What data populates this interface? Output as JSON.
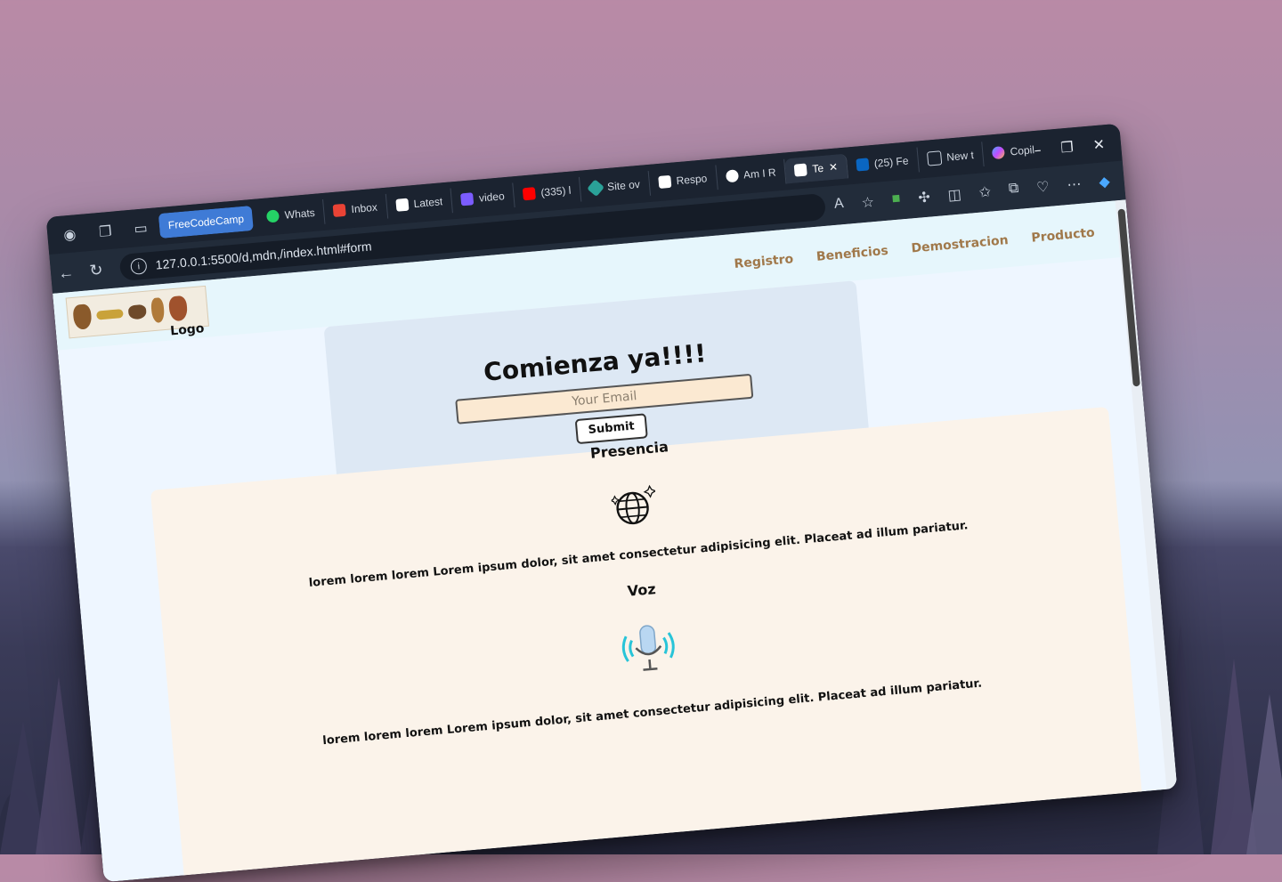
{
  "browser": {
    "tab_group_label": "FreeCodeCamp",
    "tabs": [
      {
        "label": "Whats",
        "color": "#25d366"
      },
      {
        "label": "Inbox",
        "color": "#ea4335"
      },
      {
        "label": "Latest",
        "color": "#ffffff"
      },
      {
        "label": "video",
        "color": "#7b5cff"
      },
      {
        "label": "(335) l",
        "color": "#ff0000"
      },
      {
        "label": "Site ov",
        "color": "#2aa198"
      },
      {
        "label": "Respo",
        "color": "#ffffff"
      },
      {
        "label": "Am I R",
        "color": "#ffffff"
      },
      {
        "label": "Te",
        "color": "#ffffff",
        "active": true
      },
      {
        "label": "(25) Fe",
        "color": "#0a66c2"
      },
      {
        "label": "New t",
        "color": "#c9d2de"
      },
      {
        "label": "Copilo",
        "color": "#7b5cff"
      }
    ],
    "url": "127.0.0.1:5500/d,mdn,/index.html#form"
  },
  "site": {
    "logo_label": "Logo",
    "nav": [
      "Registro",
      "Beneficios",
      "Demostracion",
      "Producto"
    ],
    "form": {
      "title": "Comienza ya!!!!",
      "email_placeholder": "Your Email",
      "submit_label": "Submit"
    },
    "features": [
      {
        "title": "Presencia",
        "icon": "globe-sparkle-icon",
        "text": "lorem lorem lorem Lorem ipsum dolor, sit amet consectetur adipisicing elit. Placeat ad illum pariatur."
      },
      {
        "title": "Voz",
        "icon": "microphone-icon",
        "text": "lorem lorem lorem Lorem ipsum dolor, sit amet consectetur adipisicing elit. Placeat ad illum pariatur."
      }
    ]
  }
}
